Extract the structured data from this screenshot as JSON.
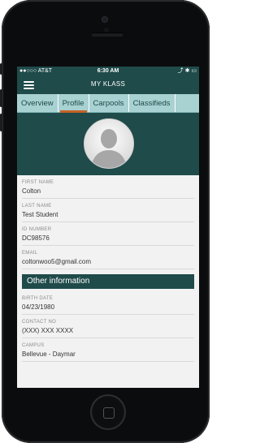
{
  "colors": {
    "primary": "#1f4b4a",
    "tab_bg": "#a8d1d2",
    "tab_active_underline": "#c46226",
    "background": "#f2f2f2"
  },
  "status_bar": {
    "carrier": "●●○○○ AT&T",
    "time": "6:30 AM",
    "right": "⤴ ✱ ▭"
  },
  "navbar": {
    "menu_icon": "hamburger-icon",
    "title": "MY KLASS"
  },
  "tabs": [
    {
      "label": "Overview",
      "active": false
    },
    {
      "label": "Profile",
      "active": true
    },
    {
      "label": "Carpools",
      "active": false
    },
    {
      "label": "Classifieds",
      "active": false
    }
  ],
  "profile": {
    "avatar_icon": "user-silhouette-icon",
    "fields": [
      {
        "label": "FIRST NAME",
        "value": "Colton"
      },
      {
        "label": "LAST NAME",
        "value": "Test Student"
      },
      {
        "label": "ID NUMBER",
        "value": "DC98576"
      },
      {
        "label": "EMAIL",
        "value": "coltonwoo5@gmail.com"
      }
    ],
    "section_title": "Other information",
    "other_fields": [
      {
        "label": "BIRTH DATE",
        "value": "04/23/1980"
      },
      {
        "label": "CONTACT NO",
        "value": "(XXX) XXX XXXX"
      },
      {
        "label": "CAMPUS",
        "value": "Bellevue - Daymar"
      }
    ]
  }
}
